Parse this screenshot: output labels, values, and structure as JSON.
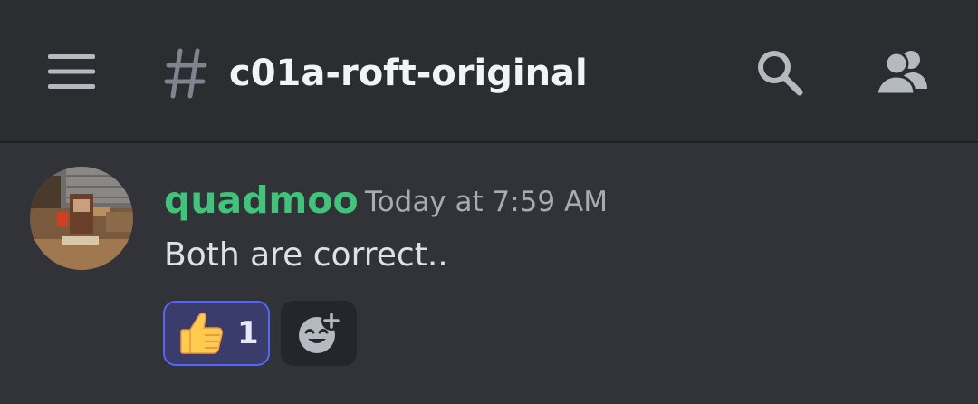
{
  "header": {
    "channel_name": "c01a-roft-original",
    "icons": {
      "menu": "hamburger-menu-icon",
      "channel": "hash-icon",
      "search": "search-icon",
      "members": "members-icon"
    }
  },
  "message": {
    "username": "quadmoo",
    "timestamp": "Today at 7:59 AM",
    "content": "Both are correct..",
    "reactions": [
      {
        "emoji": "thumbs-up",
        "count": "1",
        "selected": true
      }
    ],
    "add_reaction_icon": "add-reaction-icon"
  },
  "colors": {
    "header_bg": "#2b2d31",
    "chat_bg": "#313338",
    "username": "#3fc47a",
    "timestamp": "#a8abb3",
    "reaction_border": "#5865f2"
  }
}
